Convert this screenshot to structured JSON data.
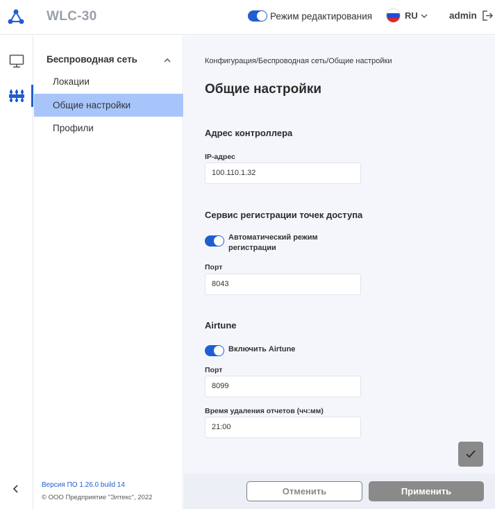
{
  "header": {
    "app_title": "WLC-30",
    "edit_mode_label": "Режим редактирования",
    "language": "RU",
    "user": "admin"
  },
  "sidebar": {
    "section_title": "Беспроводная сеть",
    "items": [
      {
        "label": "Локации"
      },
      {
        "label": "Общие настройки"
      },
      {
        "label": "Профили"
      }
    ],
    "version": "Версия ПО 1.26.0 build 14",
    "copyright": "© ООО Предприятие \"Элтекс\", 2022"
  },
  "main": {
    "breadcrumb": "Конфигурация/Беспроводная сеть/Общие настройки",
    "title": "Общие настройки",
    "controller": {
      "section_title": "Адрес контроллера",
      "ip_label": "IP-адрес",
      "ip_value": "100.110.1.32"
    },
    "registration": {
      "section_title": "Сервис регистрации точек доступа",
      "auto_mode_label": "Автоматический режим регистрации",
      "port_label": "Порт",
      "port_value": "8043"
    },
    "airtune": {
      "section_title": "Airtune",
      "enable_label": "Включить Airtune",
      "port_label": "Порт",
      "port_value": "8099",
      "delete_time_label": "Время удаления отчетов (чч:мм)",
      "delete_time_value": "21:00"
    }
  },
  "footer": {
    "cancel_label": "Отменить",
    "apply_label": "Применить"
  },
  "colors": {
    "accent": "#1f5ed1",
    "active_item": "#a7c5fa",
    "disabled_button": "#8a8a8a"
  }
}
